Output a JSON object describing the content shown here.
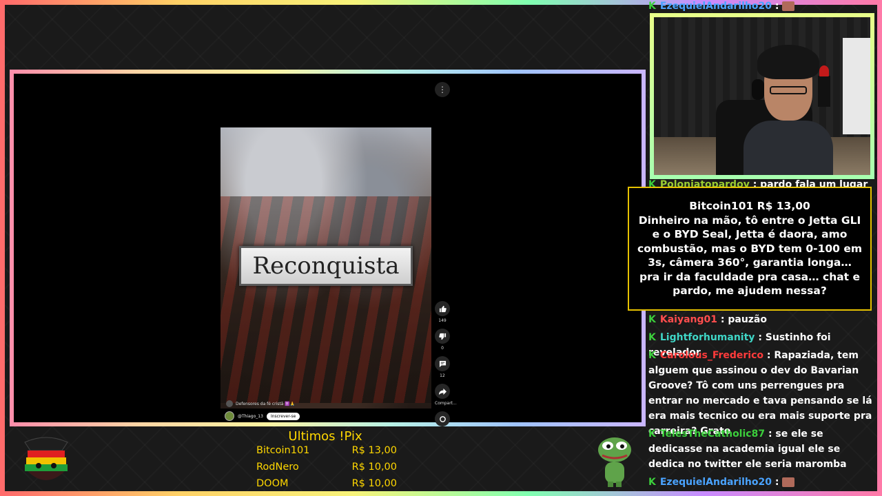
{
  "main_video": {
    "title_card": "Reconquista",
    "caption": "Defensores da fé cristã ✝️🙏",
    "channel": "@Thiago_13",
    "subscribe_label": "Inscrever-se",
    "more_icon": "vertical-dots-icon",
    "actions": [
      {
        "icon": "thumbs-up-icon",
        "count": "149"
      },
      {
        "icon": "thumbs-down-icon",
        "count": "0"
      },
      {
        "icon": "comment-icon",
        "count": "12"
      },
      {
        "icon": "share-icon",
        "count": "Compart..."
      },
      {
        "icon": "remix-icon",
        "count": ""
      }
    ]
  },
  "chat": {
    "lines": [
      {
        "user": "EzequielAndarilho20",
        "user_color": "#4aa3ff",
        "text": ":"
      },
      {
        "user": "Poloniatopardov",
        "user_color": "#9acd32",
        "text": ": pardo fala um lugar ai em"
      },
      {
        "user": "Kaiyang01",
        "user_color": "#ff4d4d",
        "text": ": pauzão"
      },
      {
        "user": "Lightforhumanity",
        "user_color": "#3fd6c6",
        "text": ": Sustinho foi revelador"
      },
      {
        "user": "Carolous_Frederico",
        "user_color": "#ff3b3b",
        "text": ": Rapaziada, tem alguem que assinou o dev do Bavarian Groove? Tô com uns perrengues pra entrar no mercado e tava pensando se lá era mais tecnico ou era mais suporte pra carreira? Grato"
      },
      {
        "user": "TelesTheCatholic87",
        "user_color": "#3ccf3c",
        "text": ": se ele se dedicasse na academia igual ele se dedica no twitter ele seria maromba"
      },
      {
        "user": "EzequielAndarilho20",
        "user_color": "#4aa3ff",
        "text": ":"
      }
    ]
  },
  "donation": {
    "title": "Bitcoin101 R$ 13,00",
    "message": "Dinheiro na mão, tô entre o Jetta GLI e o BYD Seal, Jetta é daora, amo combustão, mas o BYD tem 0-100 em 3s, câmera 360°, garantia longa… pra ir da faculdade pra casa… chat e pardo, me ajudem nessa?"
  },
  "pix": {
    "title": "Ultimos !Pix",
    "entries": [
      {
        "name": "Bitcoin101",
        "amount": "R$ 13,00"
      },
      {
        "name": "RodNero",
        "amount": "R$ 10,00"
      },
      {
        "name": "DOOM",
        "amount": "R$ 10,00"
      }
    ]
  },
  "colors": {
    "accent_gold": "#ffd700",
    "donation_border": "#e6c200",
    "chat_badge": "#3ccf3c"
  }
}
